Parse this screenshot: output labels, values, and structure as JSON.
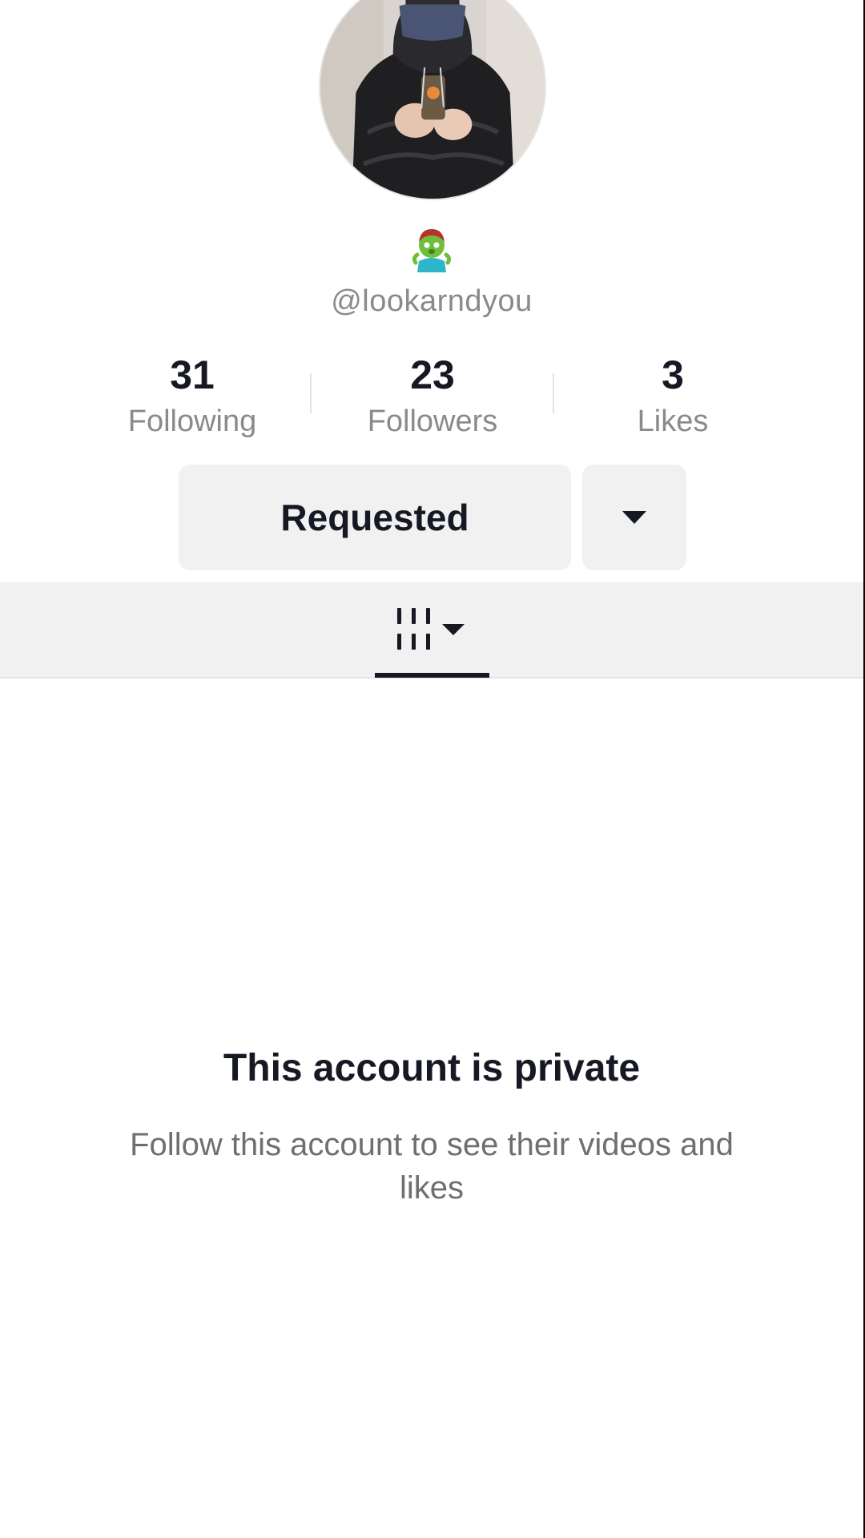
{
  "profile": {
    "display_name_icon": "man-zombie-emoji",
    "username": "@lookarndyou"
  },
  "stats": [
    {
      "count": "31",
      "label": "Following"
    },
    {
      "count": "23",
      "label": "Followers"
    },
    {
      "count": "3",
      "label": "Likes"
    }
  ],
  "actions": {
    "requested_label": "Requested",
    "dropdown_icon": "caret-down-icon"
  },
  "tabs": {
    "active": "videos-grid",
    "videos_icon": "grid-columns-icon"
  },
  "private_notice": {
    "title": "This account is private",
    "subtitle": "Follow this account to see their videos and likes"
  },
  "colors": {
    "text_primary": "#161823",
    "text_secondary": "#8a8a8a",
    "button_bg": "#f1f1f2"
  }
}
